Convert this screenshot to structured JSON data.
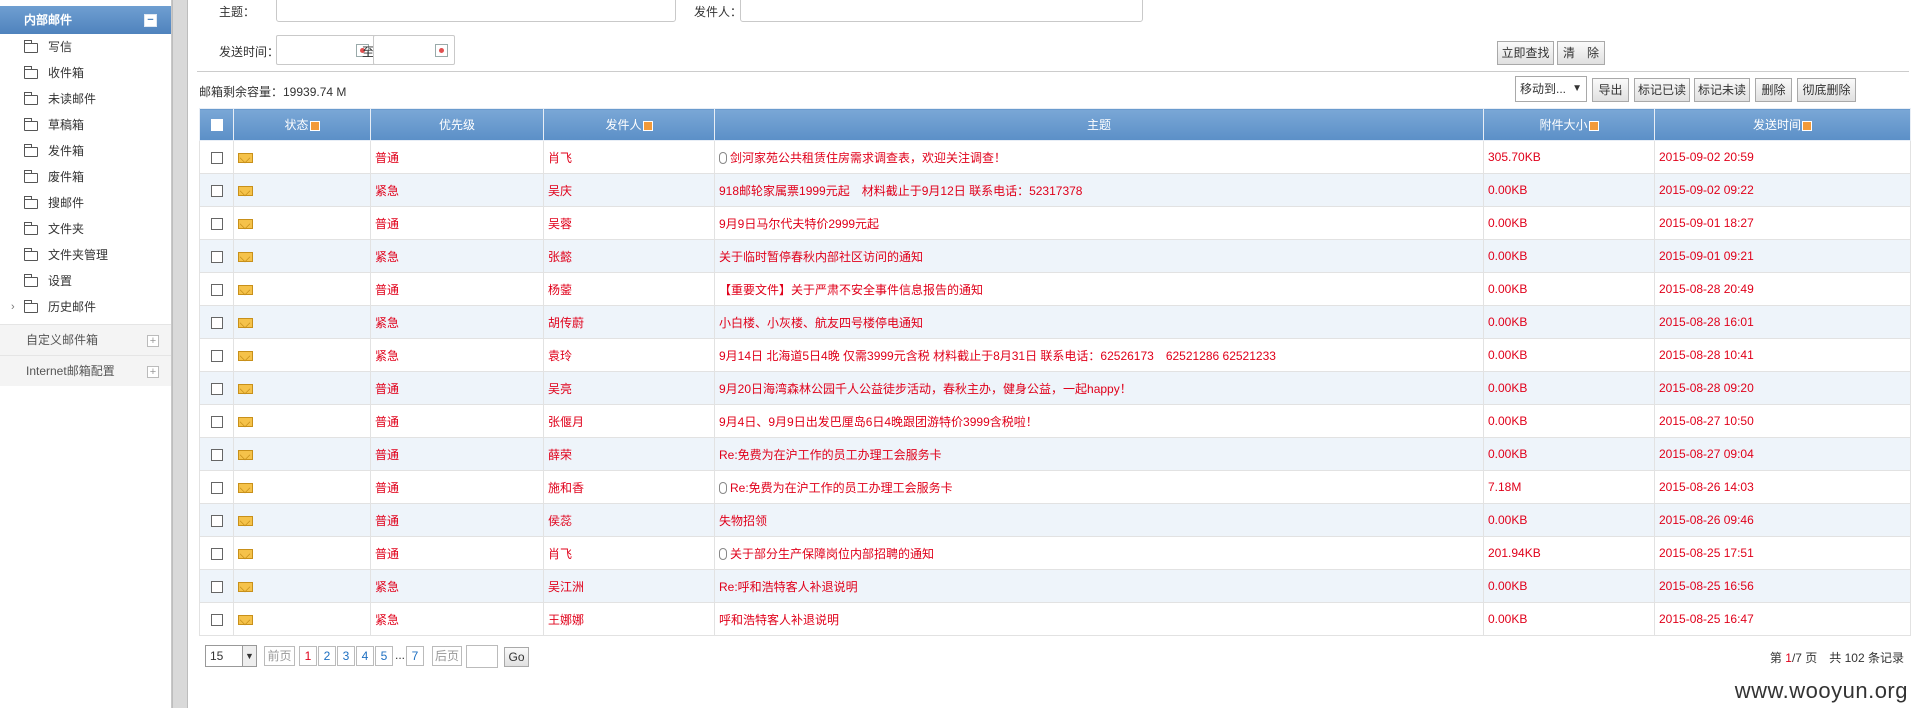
{
  "sidebar": {
    "header": "内部邮件",
    "collapse_symbol": "−",
    "items": [
      {
        "label": "写信"
      },
      {
        "label": "收件箱"
      },
      {
        "label": "未读邮件"
      },
      {
        "label": "草稿箱"
      },
      {
        "label": "发件箱"
      },
      {
        "label": "废件箱"
      },
      {
        "label": "搜邮件"
      },
      {
        "label": "文件夹"
      },
      {
        "label": "文件夹管理"
      },
      {
        "label": "设置"
      },
      {
        "label": "历史邮件"
      }
    ],
    "groups": [
      {
        "label": "自定义邮件箱"
      },
      {
        "label": "Internet邮箱配置"
      }
    ]
  },
  "search": {
    "subject_label": "主题：",
    "subject_value": "",
    "sender_label": "发件人：",
    "sender_value": "",
    "date_label": "发送时间：",
    "date_to": "至",
    "search_button": "立即查找",
    "clear_button": "清　除"
  },
  "toolbar": {
    "capacity": "邮箱剩余容量：19939.74 M",
    "move_to": "移动到...",
    "export": "导出",
    "mark_read": "标记已读",
    "mark_unread": "标记未读",
    "delete": "删除",
    "delete_permanent": "彻底删除"
  },
  "table": {
    "headers": {
      "status": "状态",
      "priority": "优先级",
      "sender": "发件人",
      "subject": "主题",
      "size": "附件大小",
      "time": "发送时间"
    },
    "rows": [
      {
        "priority": "普通",
        "sender": "肖飞",
        "subject": "剑河家苑公共租赁住房需求调查表，欢迎关注调查！",
        "attach": true,
        "size": "305.70KB",
        "time": "2015-09-02 20:59"
      },
      {
        "priority": "紧急",
        "sender": "吴庆",
        "subject": "918邮轮家属票1999元起　材料截止于9月12日 联系电话：52317378",
        "attach": false,
        "size": "0.00KB",
        "time": "2015-09-02 09:22"
      },
      {
        "priority": "普通",
        "sender": "吴蓉",
        "subject": "9月9日马尔代夫特价2999元起",
        "attach": false,
        "size": "0.00KB",
        "time": "2015-09-01 18:27"
      },
      {
        "priority": "紧急",
        "sender": "张懿",
        "subject": "关于临时暂停春秋内部社区访问的通知",
        "attach": false,
        "size": "0.00KB",
        "time": "2015-09-01 09:21"
      },
      {
        "priority": "普通",
        "sender": "杨蓥",
        "subject": "【重要文件】关于严肃不安全事件信息报告的通知",
        "attach": false,
        "size": "0.00KB",
        "time": "2015-08-28 20:49"
      },
      {
        "priority": "紧急",
        "sender": "胡传蔚",
        "subject": "小白楼、小灰楼、航友四号楼停电通知",
        "attach": false,
        "size": "0.00KB",
        "time": "2015-08-28 16:01"
      },
      {
        "priority": "紧急",
        "sender": "袁玲",
        "subject": "9月14日 北海道5日4晚 仅需3999元含税 材料截止于8月31日 联系电话：62526173　62521286 62521233",
        "attach": false,
        "size": "0.00KB",
        "time": "2015-08-28 10:41"
      },
      {
        "priority": "普通",
        "sender": "吴亮",
        "subject": "9月20日海湾森林公园千人公益徒步活动，春秋主办，健身公益，一起happy！",
        "attach": false,
        "size": "0.00KB",
        "time": "2015-08-28 09:20"
      },
      {
        "priority": "普通",
        "sender": "张偃月",
        "subject": "9月4日、9月9日出发巴厘岛6日4晚跟团游特价3999含税啦！",
        "attach": false,
        "size": "0.00KB",
        "time": "2015-08-27 10:50"
      },
      {
        "priority": "普通",
        "sender": "薛荣",
        "subject": "Re:免费为在沪工作的员工办理工会服务卡",
        "attach": false,
        "size": "0.00KB",
        "time": "2015-08-27 09:04"
      },
      {
        "priority": "普通",
        "sender": "施和香",
        "subject": "Re:免费为在沪工作的员工办理工会服务卡",
        "attach": true,
        "size": "7.18M",
        "time": "2015-08-26 14:03"
      },
      {
        "priority": "普通",
        "sender": "侯蕊",
        "subject": "失物招领",
        "attach": false,
        "size": "0.00KB",
        "time": "2015-08-26 09:46"
      },
      {
        "priority": "普通",
        "sender": "肖飞",
        "subject": "关于部分生产保障岗位内部招聘的通知",
        "attach": true,
        "size": "201.94KB",
        "time": "2015-08-25 17:51"
      },
      {
        "priority": "紧急",
        "sender": "吴江洲",
        "subject": "Re:呼和浩特客人补退说明",
        "attach": false,
        "size": "0.00KB",
        "time": "2015-08-25 16:56"
      },
      {
        "priority": "紧急",
        "sender": "王娜娜",
        "subject": "呼和浩特客人补退说明",
        "attach": false,
        "size": "0.00KB",
        "time": "2015-08-25 16:47"
      }
    ]
  },
  "pager": {
    "page_size": "15",
    "prev": "前页",
    "pages": [
      "1",
      "2",
      "3",
      "4",
      "5"
    ],
    "ellipsis": "...",
    "last": "7",
    "next": "后页",
    "go": "Go",
    "jump_value": "",
    "info_prefix": "第 ",
    "current": "1",
    "info_mid": "/7 页　共 102 条记录"
  },
  "watermark": "www.wooyun.org",
  "colors": {
    "accent": "#5b8fc7",
    "alert_text": "#e0001a"
  }
}
